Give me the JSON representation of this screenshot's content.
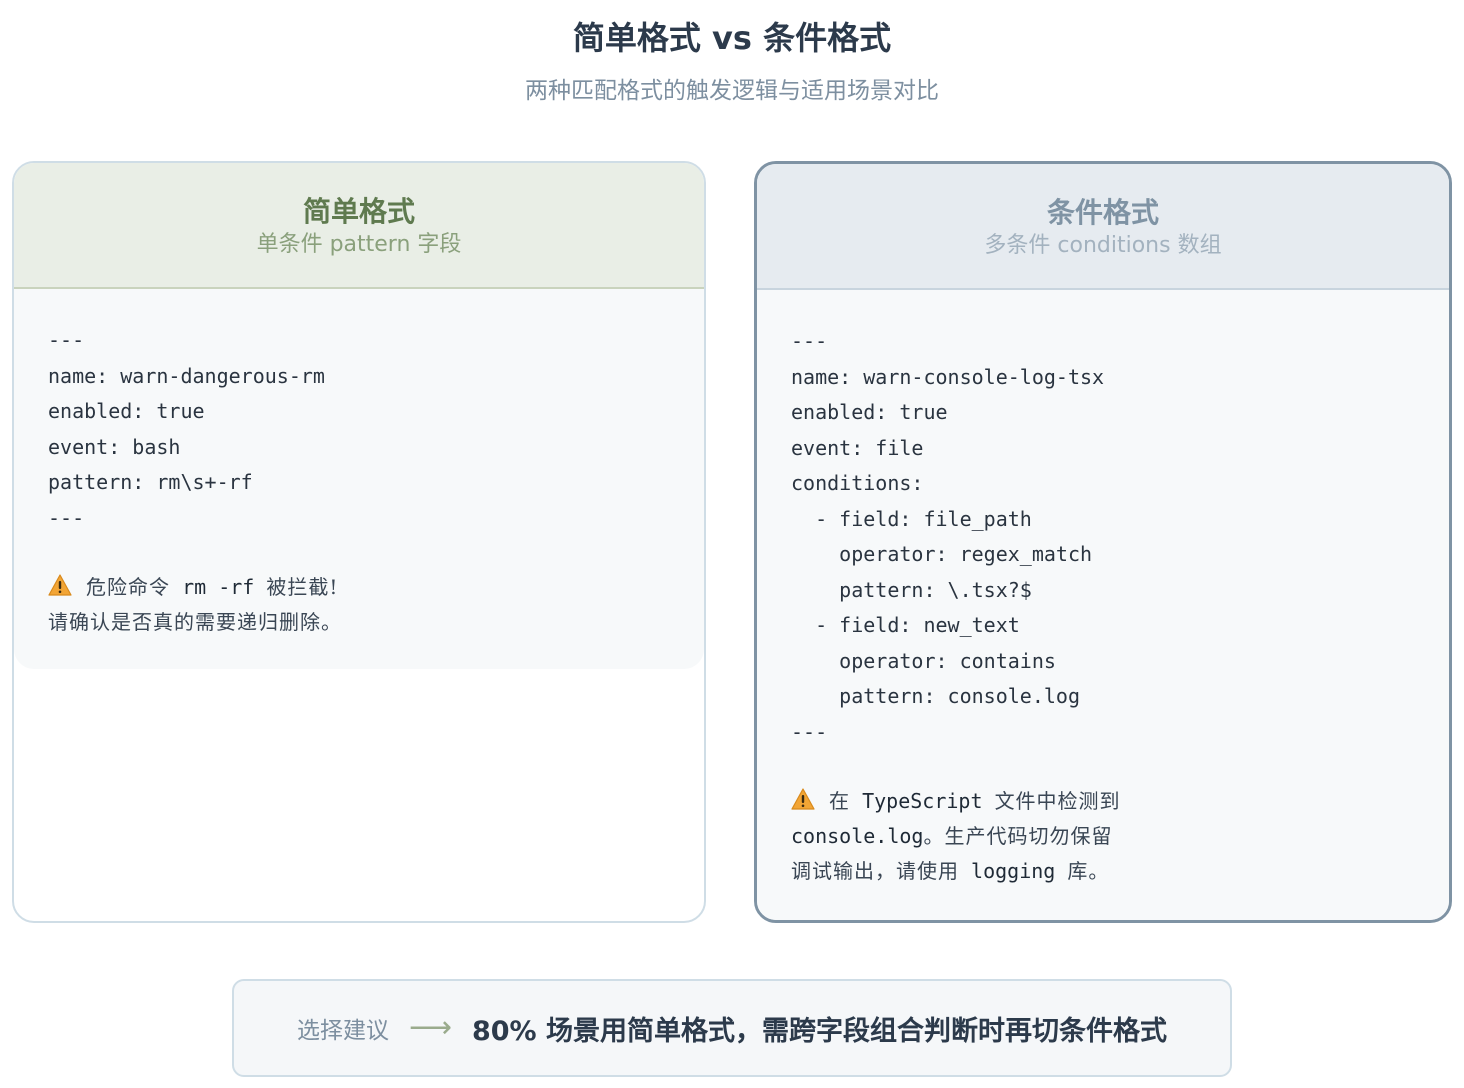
{
  "header": {
    "title": "简单格式 vs 条件格式",
    "subtitle": "两种匹配格式的触发逻辑与适用场景对比"
  },
  "simple": {
    "title": "简单格式",
    "subtitle": "单条件 pattern 字段",
    "code": [
      "---",
      "name: warn-dangerous-rm",
      "enabled: true",
      "event: bash",
      "pattern: rm\\s+-rf",
      "---"
    ],
    "message": {
      "icon": "warning-icon",
      "line1_a": "危险命令",
      "line1_code": "rm -rf",
      "line1_b": "被拦截!",
      "line2": "请确认是否真的需要递归删除。"
    }
  },
  "conditional": {
    "title": "条件格式",
    "subtitle": "多条件 conditions 数组",
    "code": [
      "---",
      "name: warn-console-log-tsx",
      "enabled: true",
      "event: file",
      "conditions:",
      "  - field: file_path",
      "    operator: regex_match",
      "    pattern: \\.tsx?$",
      "  - field: new_text",
      "    operator: contains",
      "    pattern: console.log",
      "---"
    ],
    "message": {
      "icon": "warning-icon",
      "line1_a": "在",
      "line1_code": "TypeScript",
      "line1_b": "文件中检测到",
      "line2_code": "console.log",
      "line2_b": "。生产代码切勿保留",
      "line3_a": "调试输出，请使用",
      "line3_code": "logging",
      "line3_b": "库。"
    }
  },
  "footer": {
    "label": "选择建议",
    "arrow": "⟶",
    "text": "80% 场景用简单格式，需跨字段组合判断时再切条件格式"
  },
  "colors": {
    "simple_accent": "#5f7a4f",
    "conditional_accent": "#7f93a4",
    "title": "#2c3a4b",
    "muted": "#7d8fa0",
    "warning": "#f0a030"
  }
}
